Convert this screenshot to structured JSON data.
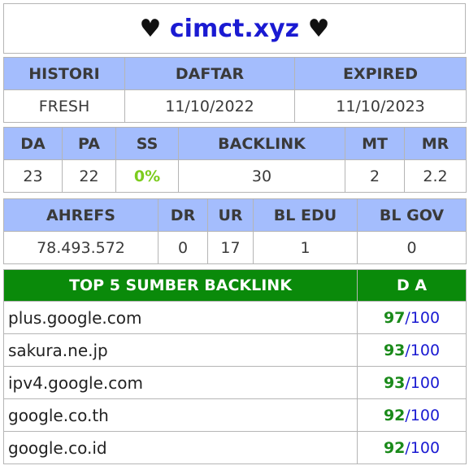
{
  "header": {
    "heart_left": "♥",
    "domain": "cimct.xyz",
    "heart_right": "♥"
  },
  "registration": {
    "headers": [
      "HISTORI",
      "DAFTAR",
      "EXPIRED"
    ],
    "values": [
      "FRESH",
      "11/10/2022",
      "11/10/2023"
    ]
  },
  "metrics": {
    "headers": [
      "DA",
      "PA",
      "SS",
      "BACKLINK",
      "MT",
      "MR"
    ],
    "values": [
      "23",
      "22",
      "0%",
      "30",
      "2",
      "2.2"
    ]
  },
  "ahrefs": {
    "headers": [
      "AHREFS",
      "DR",
      "UR",
      "BL EDU",
      "BL GOV"
    ],
    "values": [
      "78.493.572",
      "0",
      "17",
      "1",
      "0"
    ]
  },
  "top_backlinks": {
    "header_source": "TOP 5 SUMBER BACKLINK",
    "header_da": "D A",
    "separator": "/",
    "max": "100",
    "rows": [
      {
        "site": "plus.google.com",
        "da": "97"
      },
      {
        "site": "sakura.ne.jp",
        "da": "93"
      },
      {
        "site": "ipv4.google.com",
        "da": "93"
      },
      {
        "site": "google.co.th",
        "da": "92"
      },
      {
        "site": "google.co.id",
        "da": "92"
      }
    ]
  },
  "colors": {
    "header_bg": "#a4bdfd",
    "top_header_bg": "#0a8a0a",
    "domain_color": "#1a1ad2",
    "ss_color": "#7ccc1e",
    "da_value_color": "#1a8a1a"
  }
}
